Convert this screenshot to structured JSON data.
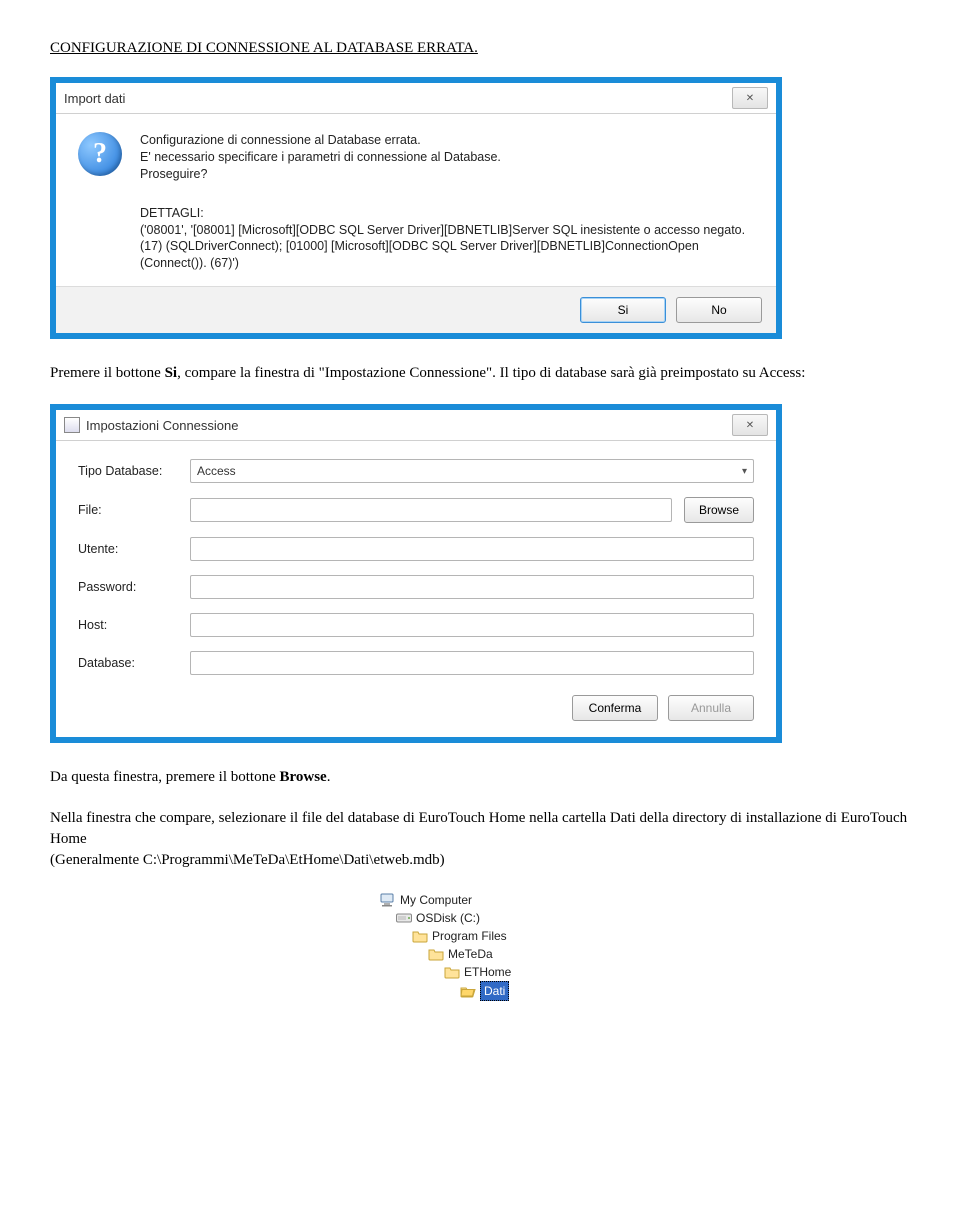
{
  "doc": {
    "title": "CONFIGURAZIONE DI CONNESSIONE AL DATABASE ERRATA.",
    "para1_a": "Premere il bottone ",
    "para1_b": "Si",
    "para1_c": ", compare la finestra di \"Impostazione Connessione\". Il tipo di database sarà già preimpostato su Access:",
    "para2_a": "Da questa finestra, premere il bottone ",
    "para2_b": "Browse",
    "para2_c": ".",
    "para3": "Nella finestra che compare, selezionare il file del database di EuroTouch Home  nella cartella Dati della directory di installazione di EuroTouch Home",
    "para4": "(Generalmente C:\\Programmi\\MeTeDa\\EtHome\\Dati\\etweb.mdb)"
  },
  "dialog1": {
    "title": "Import dati",
    "close_glyph": "✕",
    "msg_line1": "Configurazione di connessione al Database errata.",
    "msg_line2": "E' necessario specificare i parametri di connessione al Database.",
    "msg_line3": "Proseguire?",
    "details_label": "DETTAGLI:",
    "details_body": "('08001', '[08001] [Microsoft][ODBC SQL Server Driver][DBNETLIB]Server SQL inesistente o accesso negato. (17) (SQLDriverConnect); [01000] [Microsoft][ODBC SQL Server Driver][DBNETLIB]ConnectionOpen (Connect()). (67)')",
    "btn_yes": "Si",
    "btn_no": "No"
  },
  "dialog2": {
    "title": "Impostazioni Connessione",
    "close_glyph": "✕",
    "labels": {
      "tipo": "Tipo Database:",
      "file": "File:",
      "utente": "Utente:",
      "password": "Password:",
      "host": "Host:",
      "database": "Database:"
    },
    "values": {
      "tipo": "Access",
      "file": "",
      "utente": "",
      "password": "",
      "host": "",
      "database": ""
    },
    "btn_browse": "Browse",
    "btn_confirm": "Conferma",
    "btn_cancel": "Annulla"
  },
  "tree": {
    "n0": "My Computer",
    "n1": "OSDisk (C:)",
    "n2": "Program Files",
    "n3": "MeTeDa",
    "n4": "ETHome",
    "n5": "Dati"
  }
}
